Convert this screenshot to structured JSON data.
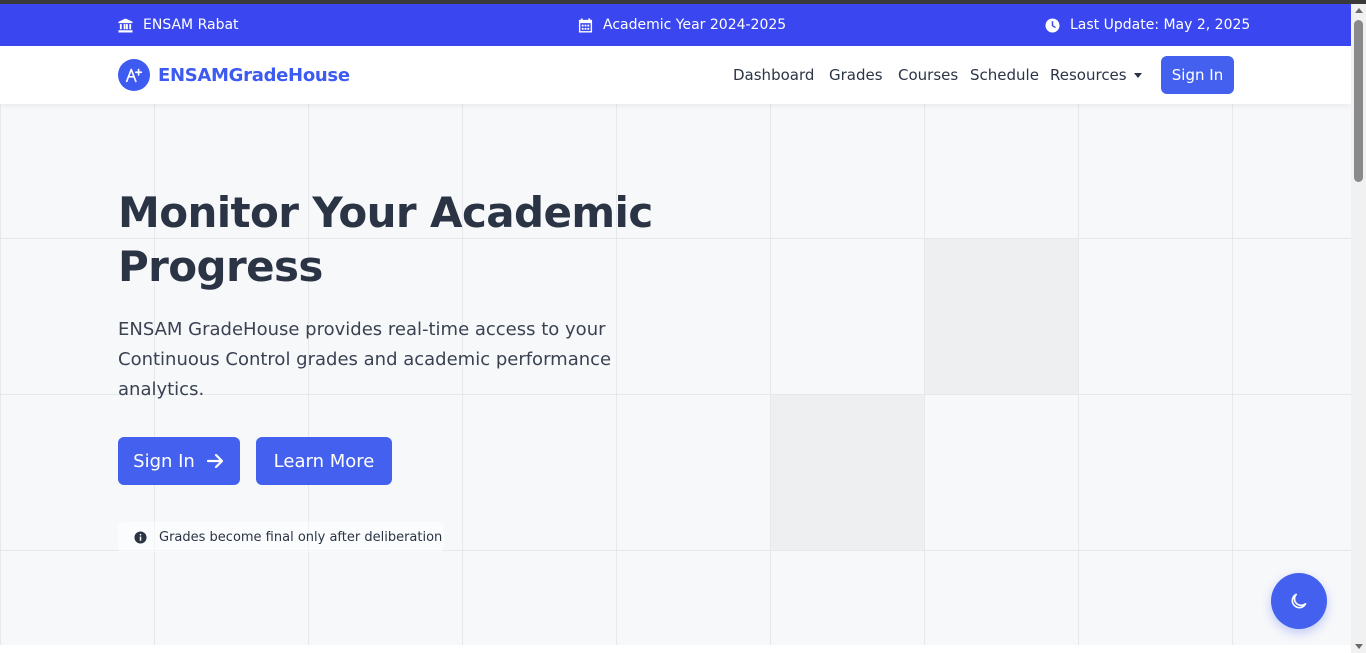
{
  "topbar": {
    "institution": "ENSAM Rabat",
    "academic_year": "Academic Year 2024-2025",
    "last_update": "Last Update: May 2, 2025",
    "institution_icon": "university-icon",
    "calendar_icon": "calendar-icon",
    "clock_icon": "clock-icon",
    "bg_color": "#3a46ef"
  },
  "navbar": {
    "brand": "ENSAMGradeHouse",
    "logo_icon": "grade-a-plus-icon",
    "links": [
      "Dashboard",
      "Grades",
      "Courses",
      "Schedule",
      "Resources"
    ],
    "sign_in_label": "Sign In",
    "accent_color": "#4361ee"
  },
  "hero": {
    "title": "Monitor Your Academic Progress",
    "lead": "ENSAM GradeHouse provides real-time access to your Continuous Control grades and academic performance analytics.",
    "sign_in_label": "Sign In",
    "learn_more_label": "Learn More",
    "arrow_icon": "arrow-right-icon",
    "note": "Grades become final only after deliberation",
    "note_icon": "info-circle-icon"
  },
  "theme_toggle": {
    "icon": "moon-icon"
  }
}
